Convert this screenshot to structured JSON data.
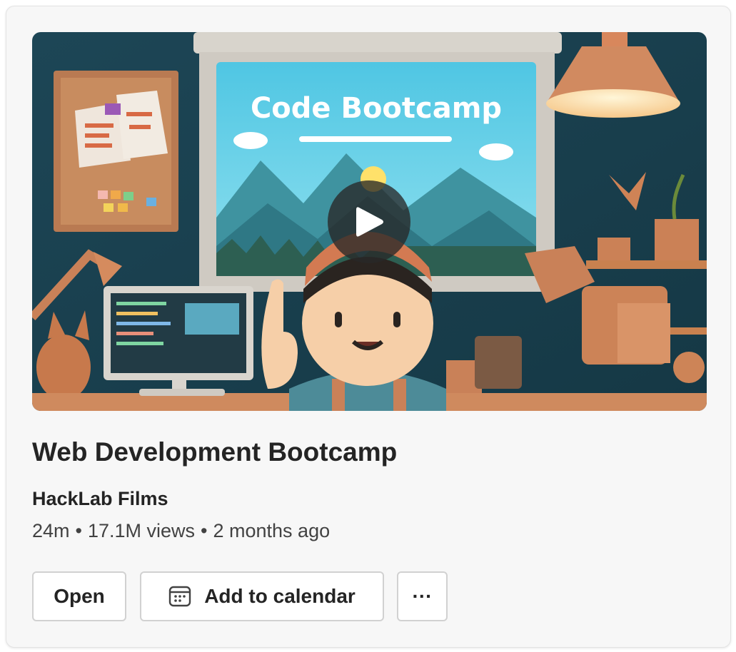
{
  "video": {
    "thumbnail_label": "Code Bootcamp",
    "title": "Web Development Bootcamp",
    "channel": "HackLab Films",
    "duration": "24m",
    "views": "17.1M views",
    "age": "2 months ago",
    "separator": "•"
  },
  "actions": {
    "open_label": "Open",
    "calendar_label": "Add to calendar",
    "more_label": "···"
  },
  "icons": {
    "play": "play-icon",
    "calendar": "calendar-icon",
    "more": "more-icon"
  },
  "colors": {
    "card_bg": "#f7f7f7",
    "wall": "#1f4a5a",
    "clay": "#c98158",
    "screen_sky": "#5fd0e8"
  }
}
